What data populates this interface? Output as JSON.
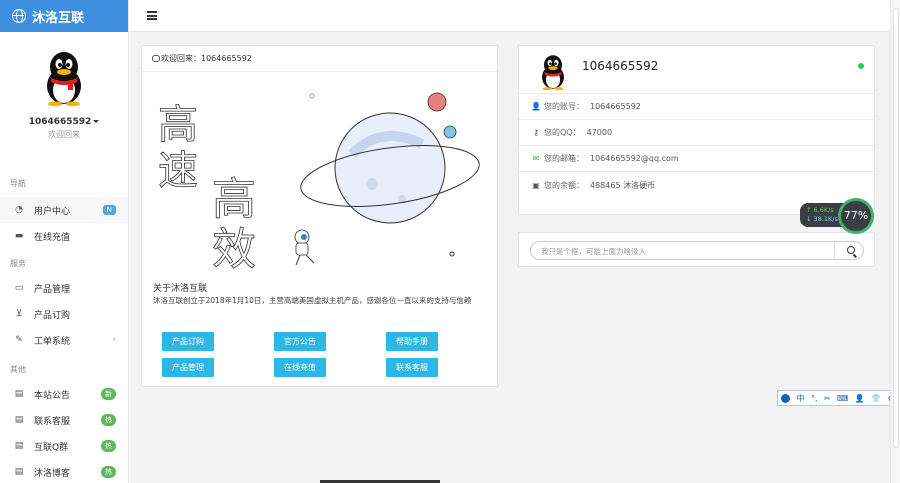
{
  "brand": {
    "name": "沐洛互联"
  },
  "profile": {
    "username": "1064665592",
    "subtitle": "欢迎回来"
  },
  "sidebar": {
    "sections": [
      {
        "title": "导航",
        "items": [
          {
            "label": "用户中心",
            "icon": "dashboard-icon",
            "badge": "N",
            "badge_color": "#4fa8d8"
          },
          {
            "label": "在线充值",
            "icon": "card-icon"
          }
        ]
      },
      {
        "title": "服务",
        "items": [
          {
            "label": "产品管理",
            "icon": "inbox-icon"
          },
          {
            "label": "产品订购",
            "icon": "cart-icon"
          },
          {
            "label": "工单系统",
            "icon": "edit-icon",
            "chevron": "›"
          }
        ]
      },
      {
        "title": "其他",
        "items": [
          {
            "label": "本站公告",
            "icon": "document-icon",
            "badge": "新",
            "badge_color": "#5cb85c"
          },
          {
            "label": "联系客服",
            "icon": "document-icon",
            "badge": "热",
            "badge_color": "#5cb85c"
          },
          {
            "label": "互联Q群",
            "icon": "document-icon",
            "badge": "热",
            "badge_color": "#5cb85c"
          },
          {
            "label": "沐洛博客",
            "icon": "document-icon",
            "badge": "热",
            "badge_color": "#5cb85c"
          }
        ]
      }
    ]
  },
  "welcome": {
    "header": "欢迎回来：1064665592",
    "art_words": [
      "高",
      "速",
      "高",
      "效"
    ],
    "about_title": "关于沐洛互联",
    "about_text": "沐洛互联创立于2018年1月10日，主营高端美国虚拟主机产品，感谢各位一直以来的支持与信赖",
    "buttons": [
      "产品订购",
      "官方公告",
      "帮助手册",
      "产品管理",
      "在线充值",
      "联系客服"
    ]
  },
  "account": {
    "name": "1064665592",
    "rows": [
      {
        "label": "您的账号：",
        "value": "1064665592",
        "icon": "user-icon"
      },
      {
        "label": "您的QQ：",
        "value": "47000",
        "icon": "key-icon"
      },
      {
        "label": "您的邮箱：",
        "value": "1064665592@qq.com",
        "icon": "mail-icon"
      },
      {
        "label": "您的余额：",
        "value": "488465 沐洛硬币",
        "icon": "money-icon"
      }
    ]
  },
  "search": {
    "placeholder": "我只是个框，可能上面为啥没入"
  },
  "speed_widget": {
    "upload": "↑ 6.6K/s",
    "download": "↓ 38.1K/s",
    "percent": "77%"
  },
  "ime": {
    "mode": "中",
    "symbols": [
      "°,",
      "✂",
      "⌨",
      "👤",
      "👕",
      "⚙"
    ]
  },
  "colors": {
    "brand": "#3f8fe0",
    "accent": "#2db7e5",
    "online": "#2ecc40"
  }
}
